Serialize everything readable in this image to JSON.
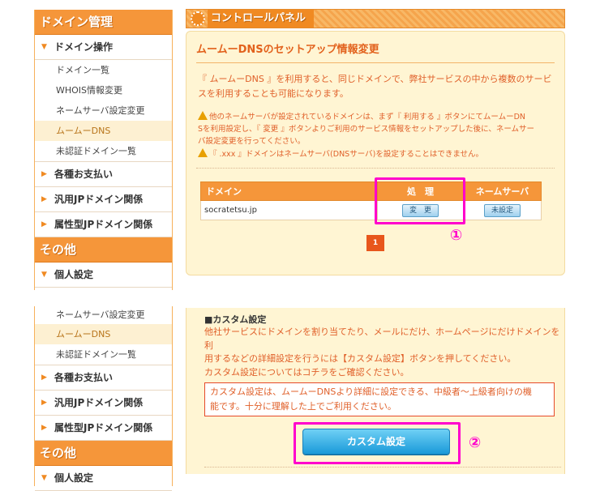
{
  "sidebar_top": {
    "header": "ドメイン管理",
    "category_domain_ops": "ドメイン操作",
    "items": [
      "ドメイン一覧",
      "WHOIS情報変更",
      "ネームサーバ設定変更",
      "ムームーDNS",
      "未認証ドメイン一覧"
    ],
    "cat_payments": "各種お支払い",
    "cat_general_jp": "汎用JPドメイン関係",
    "cat_attr_jp": "属性型JPドメイン関係",
    "header_other": "その他",
    "cat_personal": "個人設定"
  },
  "sidebar_bottom": {
    "items": [
      "ネームサーバ設定変更",
      "ムームーDNS",
      "未認証ドメイン一覧"
    ],
    "cat_payments": "各種お支払い",
    "cat_general_jp": "汎用JPドメイン関係",
    "cat_attr_jp": "属性型JPドメイン関係",
    "header_other": "その他",
    "cat_personal": "個人設定"
  },
  "control_panel": {
    "title": "コントロールパネル",
    "heading": "ムームーDNSのセットアップ情報変更",
    "intro_line1": "『 ムームーDNS 』を利用すると、同じドメインで、弊社サービスの中から複数のサービ",
    "intro_line2": "スを利用することも可能になります。",
    "warn1_line1": "他のネームサーバが設定されているドメインは、まず『 利用する 』ボタンにてムームーDN",
    "warn1_line2": "Sを利用設定し、『 変更 』ボタンよりご利用のサービス情報をセットアップした後に、ネームサー",
    "warn1_line3": "バ設定変更を行ってください。",
    "warn2": "『 .xxx 』ドメインはネームサーバ(DNSサーバ)を設定することはできません。",
    "table": {
      "col_domain": "ドメイン",
      "col_process": "処　理",
      "col_nameserver": "ネームサーバ",
      "row_domain": "socratetsu.jp",
      "btn_change": "変　更",
      "btn_unset": "未設定"
    },
    "marker1": "①",
    "page": "1"
  },
  "custom": {
    "heading": "■カスタム設定",
    "line1": "他社サービスにドメインを割り当てたり、メールにだけ、ホームページにだけドメインを利",
    "line2": "用するなどの詳細設定を行うには【カスタム設定】ボタンを押してください。",
    "line3_pre": "カスタム設定については",
    "line3_link": "コチラ",
    "line3_post": "をご確認ください。",
    "notice_line1": "カスタム設定は、ムームーDNSより詳細に設定できる、中級者～上級者向けの機",
    "notice_line2": "能です。十分に理解した上でご利用ください。",
    "button": "カスタム設定",
    "marker2": "②"
  },
  "colors": {
    "accent_orange": "#f5963a",
    "panel_bg": "#fff5d3",
    "highlight": "#ff00cc",
    "text_red": "#e0602a"
  }
}
